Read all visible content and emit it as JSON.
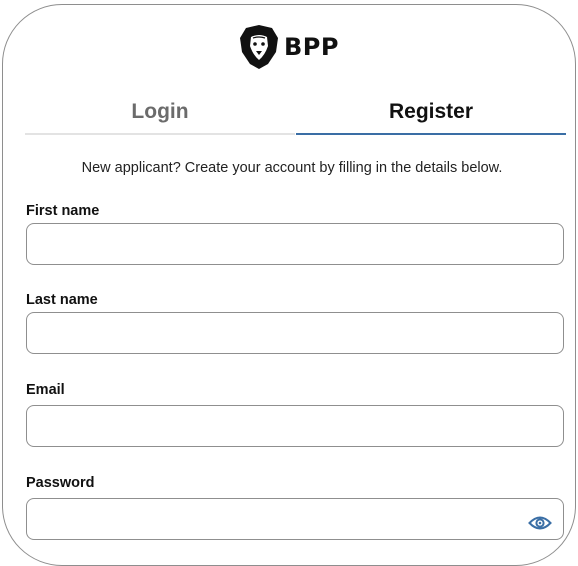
{
  "brand": {
    "name": "BPP",
    "accent_color": "#3a6ea5"
  },
  "tabs": [
    {
      "label": "Login",
      "active": false
    },
    {
      "label": "Register",
      "active": true
    }
  ],
  "intro_text": "New applicant? Create your account by filling in the details below.",
  "form": {
    "first_name": {
      "label": "First name",
      "value": ""
    },
    "last_name": {
      "label": "Last name",
      "value": ""
    },
    "email": {
      "label": "Email",
      "value": ""
    },
    "password": {
      "label": "Password",
      "value": "",
      "toggle_icon": "eye-icon"
    }
  }
}
